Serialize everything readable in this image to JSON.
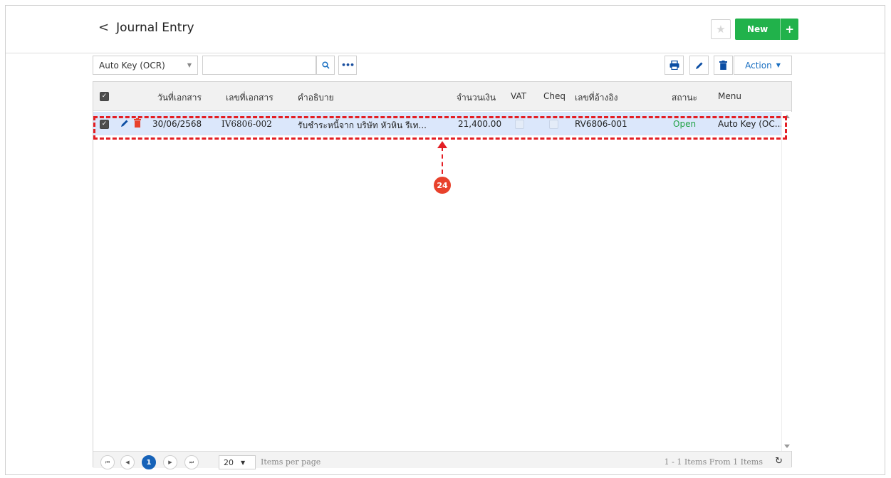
{
  "header": {
    "back_glyph": "<",
    "title": "Journal Entry",
    "new_label": "New",
    "new_plus": "+"
  },
  "toolbar": {
    "select_value": "Auto Key (OCR)",
    "search_placeholder": "",
    "more_label": "•••",
    "action_label": "Action"
  },
  "grid": {
    "columns": [
      "วันที่เอกสาร",
      "เลขที่เอกสาร",
      "คำอธิบาย",
      "จำนวนเงิน",
      "VAT",
      "Cheq",
      "เลขที่อ้างอิง",
      "สถานะ",
      "Menu"
    ],
    "rows": [
      {
        "date": "30/06/2568",
        "doc_no": "IV6806-002",
        "description": "รับชำระหนี้จาก บริษัท หัวหิน รีเท...",
        "amount": "21,400.00",
        "vat": false,
        "cheq": false,
        "ref_no": "RV6806-001",
        "status": "Open",
        "menu": "Auto Key (OC..."
      }
    ]
  },
  "annotation": {
    "badge": "24"
  },
  "pager": {
    "current_page": "1",
    "page_size": "20",
    "items_per_page_label": "Items per page",
    "info": "1 - 1 Items From 1 Items"
  },
  "colors": {
    "accent": "#1662b8",
    "new_button": "#21b24b",
    "status_open": "#21a245",
    "highlight": "#e31e24",
    "row_selected": "#dbe7fb"
  }
}
